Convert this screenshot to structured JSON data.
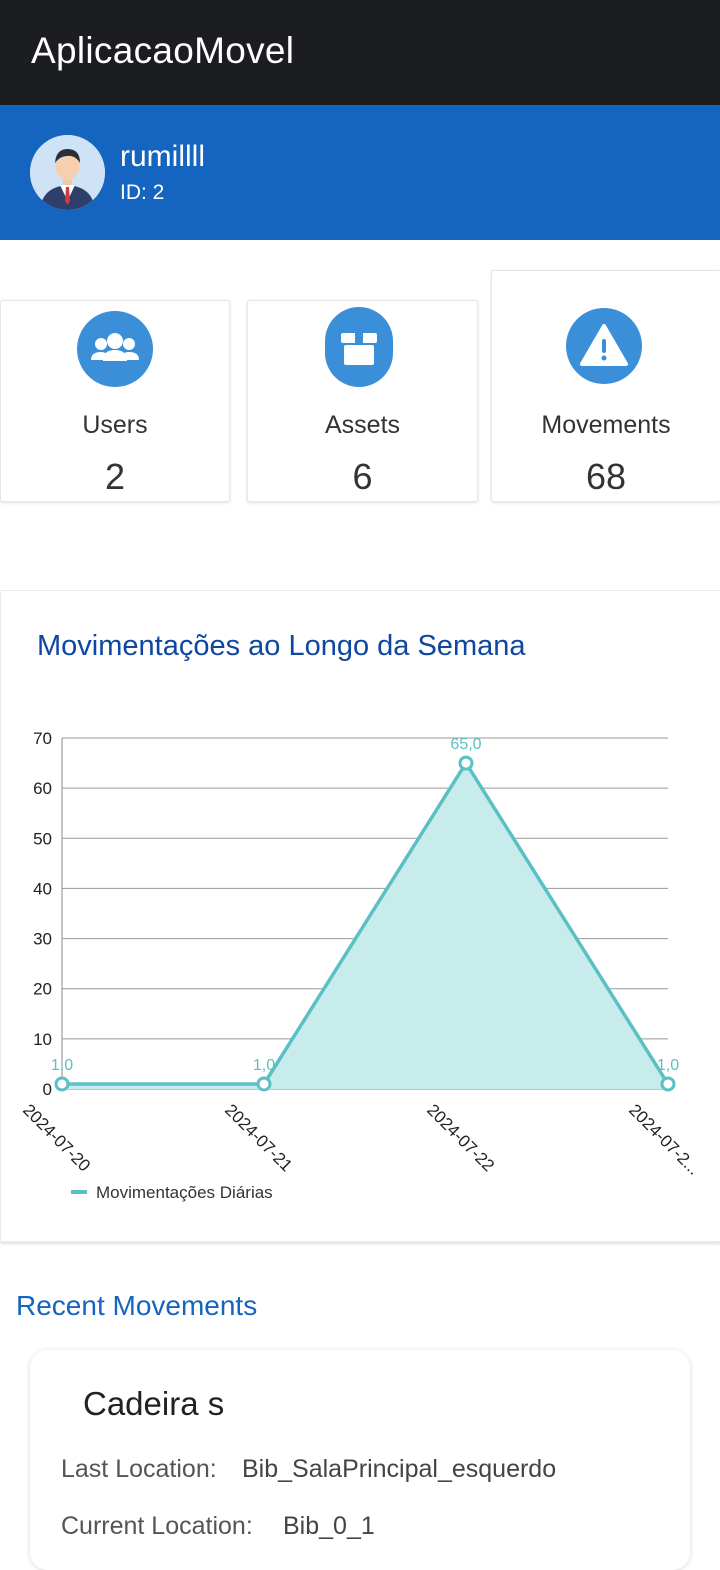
{
  "app": {
    "title": "AplicacaoMovel"
  },
  "user": {
    "name": "rumillll",
    "id_text": "ID: 2"
  },
  "stats": [
    {
      "label": "Users",
      "value": "2",
      "icon": "users-icon"
    },
    {
      "label": "Assets",
      "value": "6",
      "icon": "box-icon"
    },
    {
      "label": "Movements",
      "value": "68",
      "icon": "warning-icon"
    }
  ],
  "chart": {
    "title": "Movimentações ao Longo da Semana"
  },
  "chart_data": {
    "type": "area",
    "categories": [
      "2024-07-20",
      "2024-07-21",
      "2024-07-22",
      "2024-07-2..."
    ],
    "series": [
      {
        "name": "Movimentações Diárias",
        "values": [
          1,
          1,
          65,
          1
        ]
      }
    ],
    "data_labels": [
      "1,0",
      "1,0",
      "65,0",
      "1,0"
    ],
    "ylim": [
      0,
      70
    ],
    "yticks": [
      0,
      10,
      20,
      30,
      40,
      50,
      60,
      70
    ],
    "grid": true,
    "legend": "bottom-left",
    "colors": {
      "line": "#5bc0c4",
      "fill": "#c8ebeb"
    }
  },
  "recent": {
    "title": "Recent Movements",
    "items": [
      {
        "name": "Cadeira s",
        "last_location_label": "Last Location:",
        "last_location": "Bib_SalaPrincipal_esquerdo",
        "current_location_label": "Current Location:",
        "current_location": "Bib_0_1"
      }
    ]
  },
  "colors": {
    "appbar": "#1c1d20",
    "userbar": "#1565c0",
    "accent": "#3a8fd8"
  }
}
